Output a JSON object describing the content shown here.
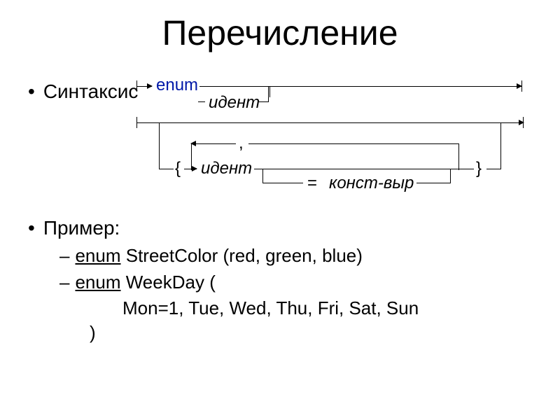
{
  "title": "Перечисление",
  "bullets": {
    "syntax": "Синтаксис",
    "example": "Пример:"
  },
  "subitems": {
    "s1_enum": "enum",
    "s1_rest": " StreetColor (red, green, blue)",
    "s2_enum": "enum",
    "s2_rest": " WeekDay (",
    "s2_line2": "Mon=1, Tue, Wed, Thu, Fri, Sat, Sun",
    "s2_line3": ")"
  },
  "diagram": {
    "keyword_enum": "enum",
    "ident": "идент",
    "ident2": "идент",
    "const_expr": "конст-выр",
    "open_brace": "{",
    "close_brace": "}",
    "comma": ",",
    "equals": "="
  }
}
